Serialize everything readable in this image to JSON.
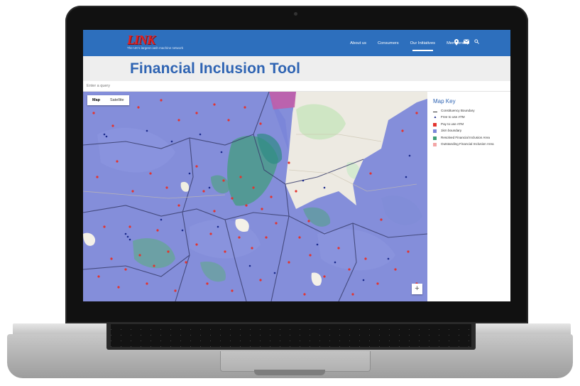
{
  "header": {
    "logo_text": "LINK",
    "logo_tagline": "The UK's largest cash machine network",
    "nav": [
      "About us",
      "Consumers",
      "Our Initiatives",
      "Membership"
    ],
    "active_nav_index": 2,
    "icons": [
      "location-icon",
      "mail-icon",
      "search-icon"
    ]
  },
  "page": {
    "title": "Financial Inclusion Tool"
  },
  "search": {
    "placeholder": "Enter a query"
  },
  "map": {
    "type_buttons": [
      "Map",
      "Satellite"
    ],
    "selected_type": "Map",
    "zoom_in_label": "+"
  },
  "legend": {
    "title": "Map Key",
    "items": [
      {
        "label": "Constituency Boundary",
        "symbol": "line",
        "color": "#333333"
      },
      {
        "label": "Free to use ATM",
        "symbol": "triangle",
        "color": "#1b2a8c"
      },
      {
        "label": "Pay to use ATM",
        "symbol": "square",
        "color": "#e3342f"
      },
      {
        "label": "1km boundary",
        "symbol": "square",
        "color": "#7b86d9"
      },
      {
        "label": "Resolved Financial Inclusion Area",
        "symbol": "square",
        "color": "#3f9e77"
      },
      {
        "label": "Outstanding Financial Inclusion Area",
        "symbol": "square",
        "color": "#f3a6a6"
      }
    ]
  },
  "colors": {
    "header_blue": "#2d6fbd",
    "title_blue": "#2f64b3",
    "logo_red": "#e52222",
    "coverage_purple": "#7b86d9",
    "resolved_green": "#3f9e77",
    "atm_red": "#e3342f",
    "atm_free": "#1b2a8c"
  }
}
